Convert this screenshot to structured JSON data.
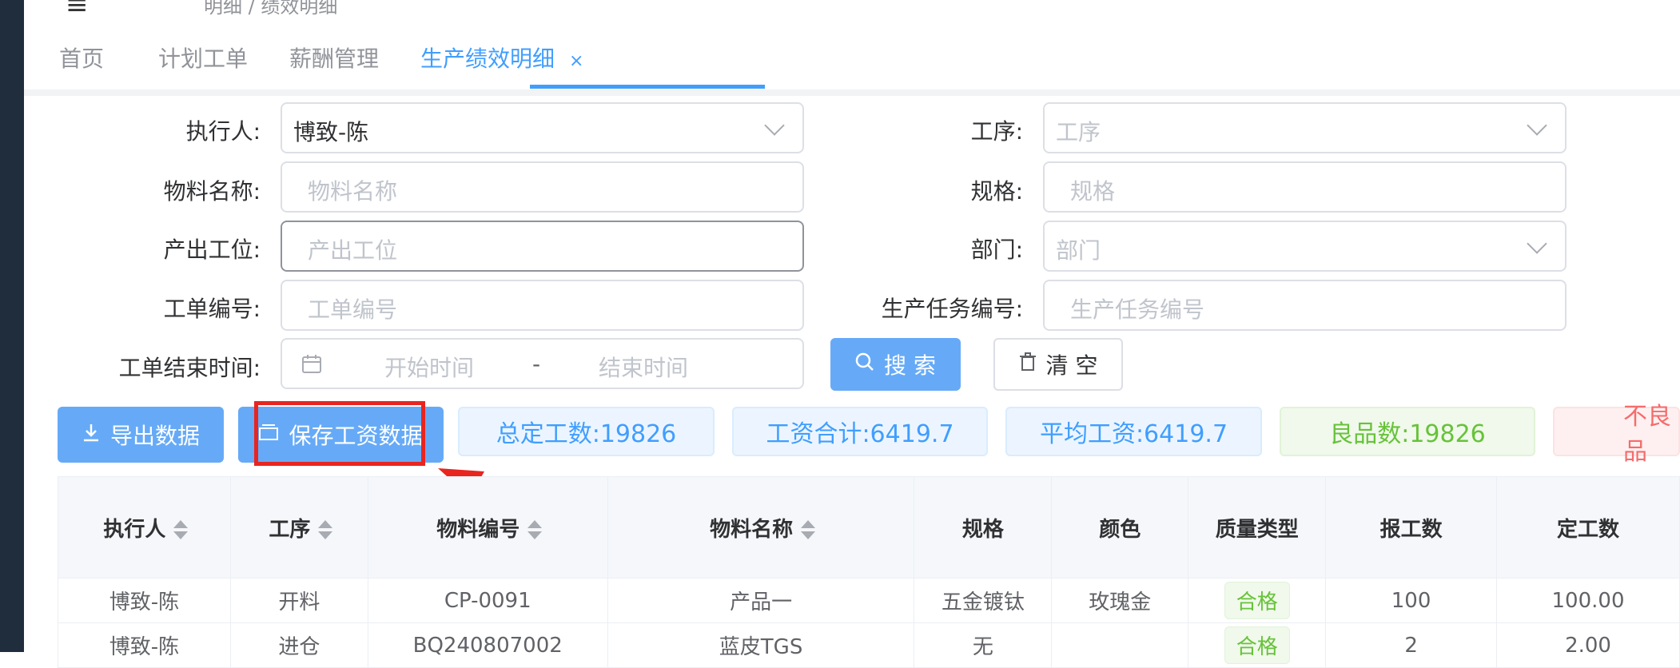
{
  "breadcrumb": "明细 / 绩效明细",
  "tabs": [
    {
      "label": "首页"
    },
    {
      "label": "计划工单"
    },
    {
      "label": "薪酬管理"
    },
    {
      "label": "生产绩效明细",
      "close": "×"
    }
  ],
  "form": {
    "executor": {
      "label": "执行人:",
      "value": "博致-陈"
    },
    "process": {
      "label": "工序:",
      "placeholder": "工序"
    },
    "material_name": {
      "label": "物料名称:",
      "placeholder": "物料名称"
    },
    "spec": {
      "label": "规格:",
      "placeholder": "规格"
    },
    "station": {
      "label": "产出工位:",
      "placeholder": "产出工位"
    },
    "department": {
      "label": "部门:",
      "placeholder": "部门"
    },
    "work_order": {
      "label": "工单编号:",
      "placeholder": "工单编号"
    },
    "task_no": {
      "label": "生产任务编号:",
      "placeholder": "生产任务编号"
    },
    "end_time": {
      "label": "工单结束时间:",
      "start_placeholder": "开始时间",
      "separator": "-",
      "end_placeholder": "结束时间"
    }
  },
  "buttons": {
    "search": "搜 索",
    "clear": "清 空",
    "export": "导出数据",
    "save_salary": "保存工资数据"
  },
  "stats": {
    "total_quota": "总定工数:19826",
    "salary_total": "工资合计:6419.7",
    "avg_salary": "平均工资:6419.7",
    "good_count": "良品数:19826",
    "bad_count": "不良品"
  },
  "table": {
    "headers": [
      "执行人",
      "工序",
      "物料编号",
      "物料名称",
      "规格",
      "颜色",
      "质量类型",
      "报工数",
      "定工数"
    ],
    "rows": [
      [
        "博致-陈",
        "开料",
        "CP-0091",
        "产品一",
        "五金镀钛",
        "玫瑰金",
        "合格",
        "100",
        "100.00"
      ],
      [
        "博致-陈",
        "进仓",
        "BQ240807002",
        "蓝皮TGS",
        "无",
        "",
        "合格",
        "2",
        "2.00"
      ]
    ]
  },
  "colors": {
    "primary": "#409eff",
    "highlight": "#e8251f",
    "success": "#67c23a",
    "danger": "#f56c6c"
  }
}
